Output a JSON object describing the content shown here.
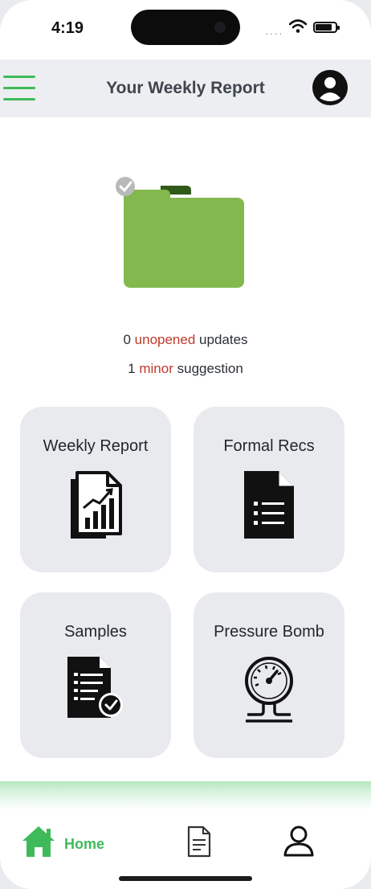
{
  "status_bar": {
    "time": "4:19"
  },
  "header": {
    "title": "Your Weekly Report"
  },
  "summary": {
    "unopened_count": "0",
    "unopened_word": "unopened",
    "unopened_suffix": "updates",
    "minor_count": "1",
    "minor_word": "minor",
    "minor_suffix": "suggestion"
  },
  "cards": [
    {
      "label": "Weekly Report",
      "icon": "report-chart-icon"
    },
    {
      "label": "Formal Recs",
      "icon": "document-list-icon"
    },
    {
      "label": "Samples",
      "icon": "checklist-verified-icon"
    },
    {
      "label": "Pressure Bomb",
      "icon": "pressure-gauge-icon"
    }
  ],
  "tab_bar": {
    "items": [
      {
        "label": "Home",
        "icon": "home-icon"
      },
      {
        "label": "",
        "icon": "document-icon"
      },
      {
        "label": "",
        "icon": "profile-icon"
      }
    ]
  },
  "colors": {
    "accent_green": "#3fba5a",
    "folder_green": "#82b84d",
    "highlight_red": "#c0392b",
    "card_bg": "#e8eaee"
  }
}
